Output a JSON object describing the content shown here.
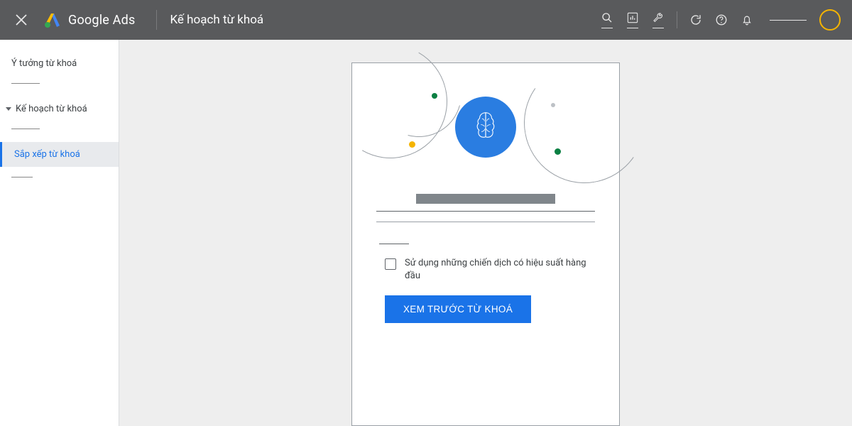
{
  "header": {
    "brand": "Google Ads",
    "page_title": "Kế hoạch từ khoá"
  },
  "sidebar": {
    "item_ideas": "Ý tưởng từ khoá",
    "item_plan": "Kế hoạch từ khoá",
    "item_organize": "Sắp xếp từ khoá"
  },
  "card": {
    "checkbox_label": "Sử dụng những chiến dịch có hiệu suất hàng đầu",
    "preview_button": "XEM TRƯỚC TỪ KHOÁ"
  }
}
